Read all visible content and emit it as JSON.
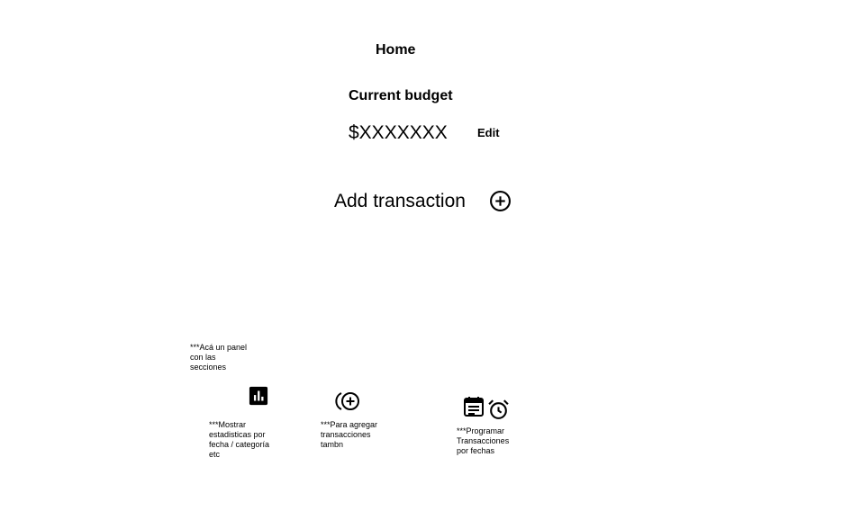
{
  "header": {
    "title": "Home"
  },
  "budget": {
    "label": "Current budget",
    "amount": "$XXXXXXX",
    "edit_label": "Edit"
  },
  "add_transaction": {
    "label": "Add transaction",
    "icon": "add-circle-icon"
  },
  "notes": {
    "panel": "***Acá un panel\ncon las\nsecciones",
    "stats": "***Mostrar\nestadisticas por\nfecha / categoría\netc",
    "add": "***Para agregar\ntransacciones\ntambn",
    "schedule": "***Programar\nTransacciones\npor fechas"
  },
  "bottom_nav": {
    "stats_icon": "bar-chart-icon",
    "add_icon": "add-circle-alt-icon",
    "calendar_icon": "calendar-note-icon",
    "alarm_icon": "alarm-clock-icon"
  }
}
